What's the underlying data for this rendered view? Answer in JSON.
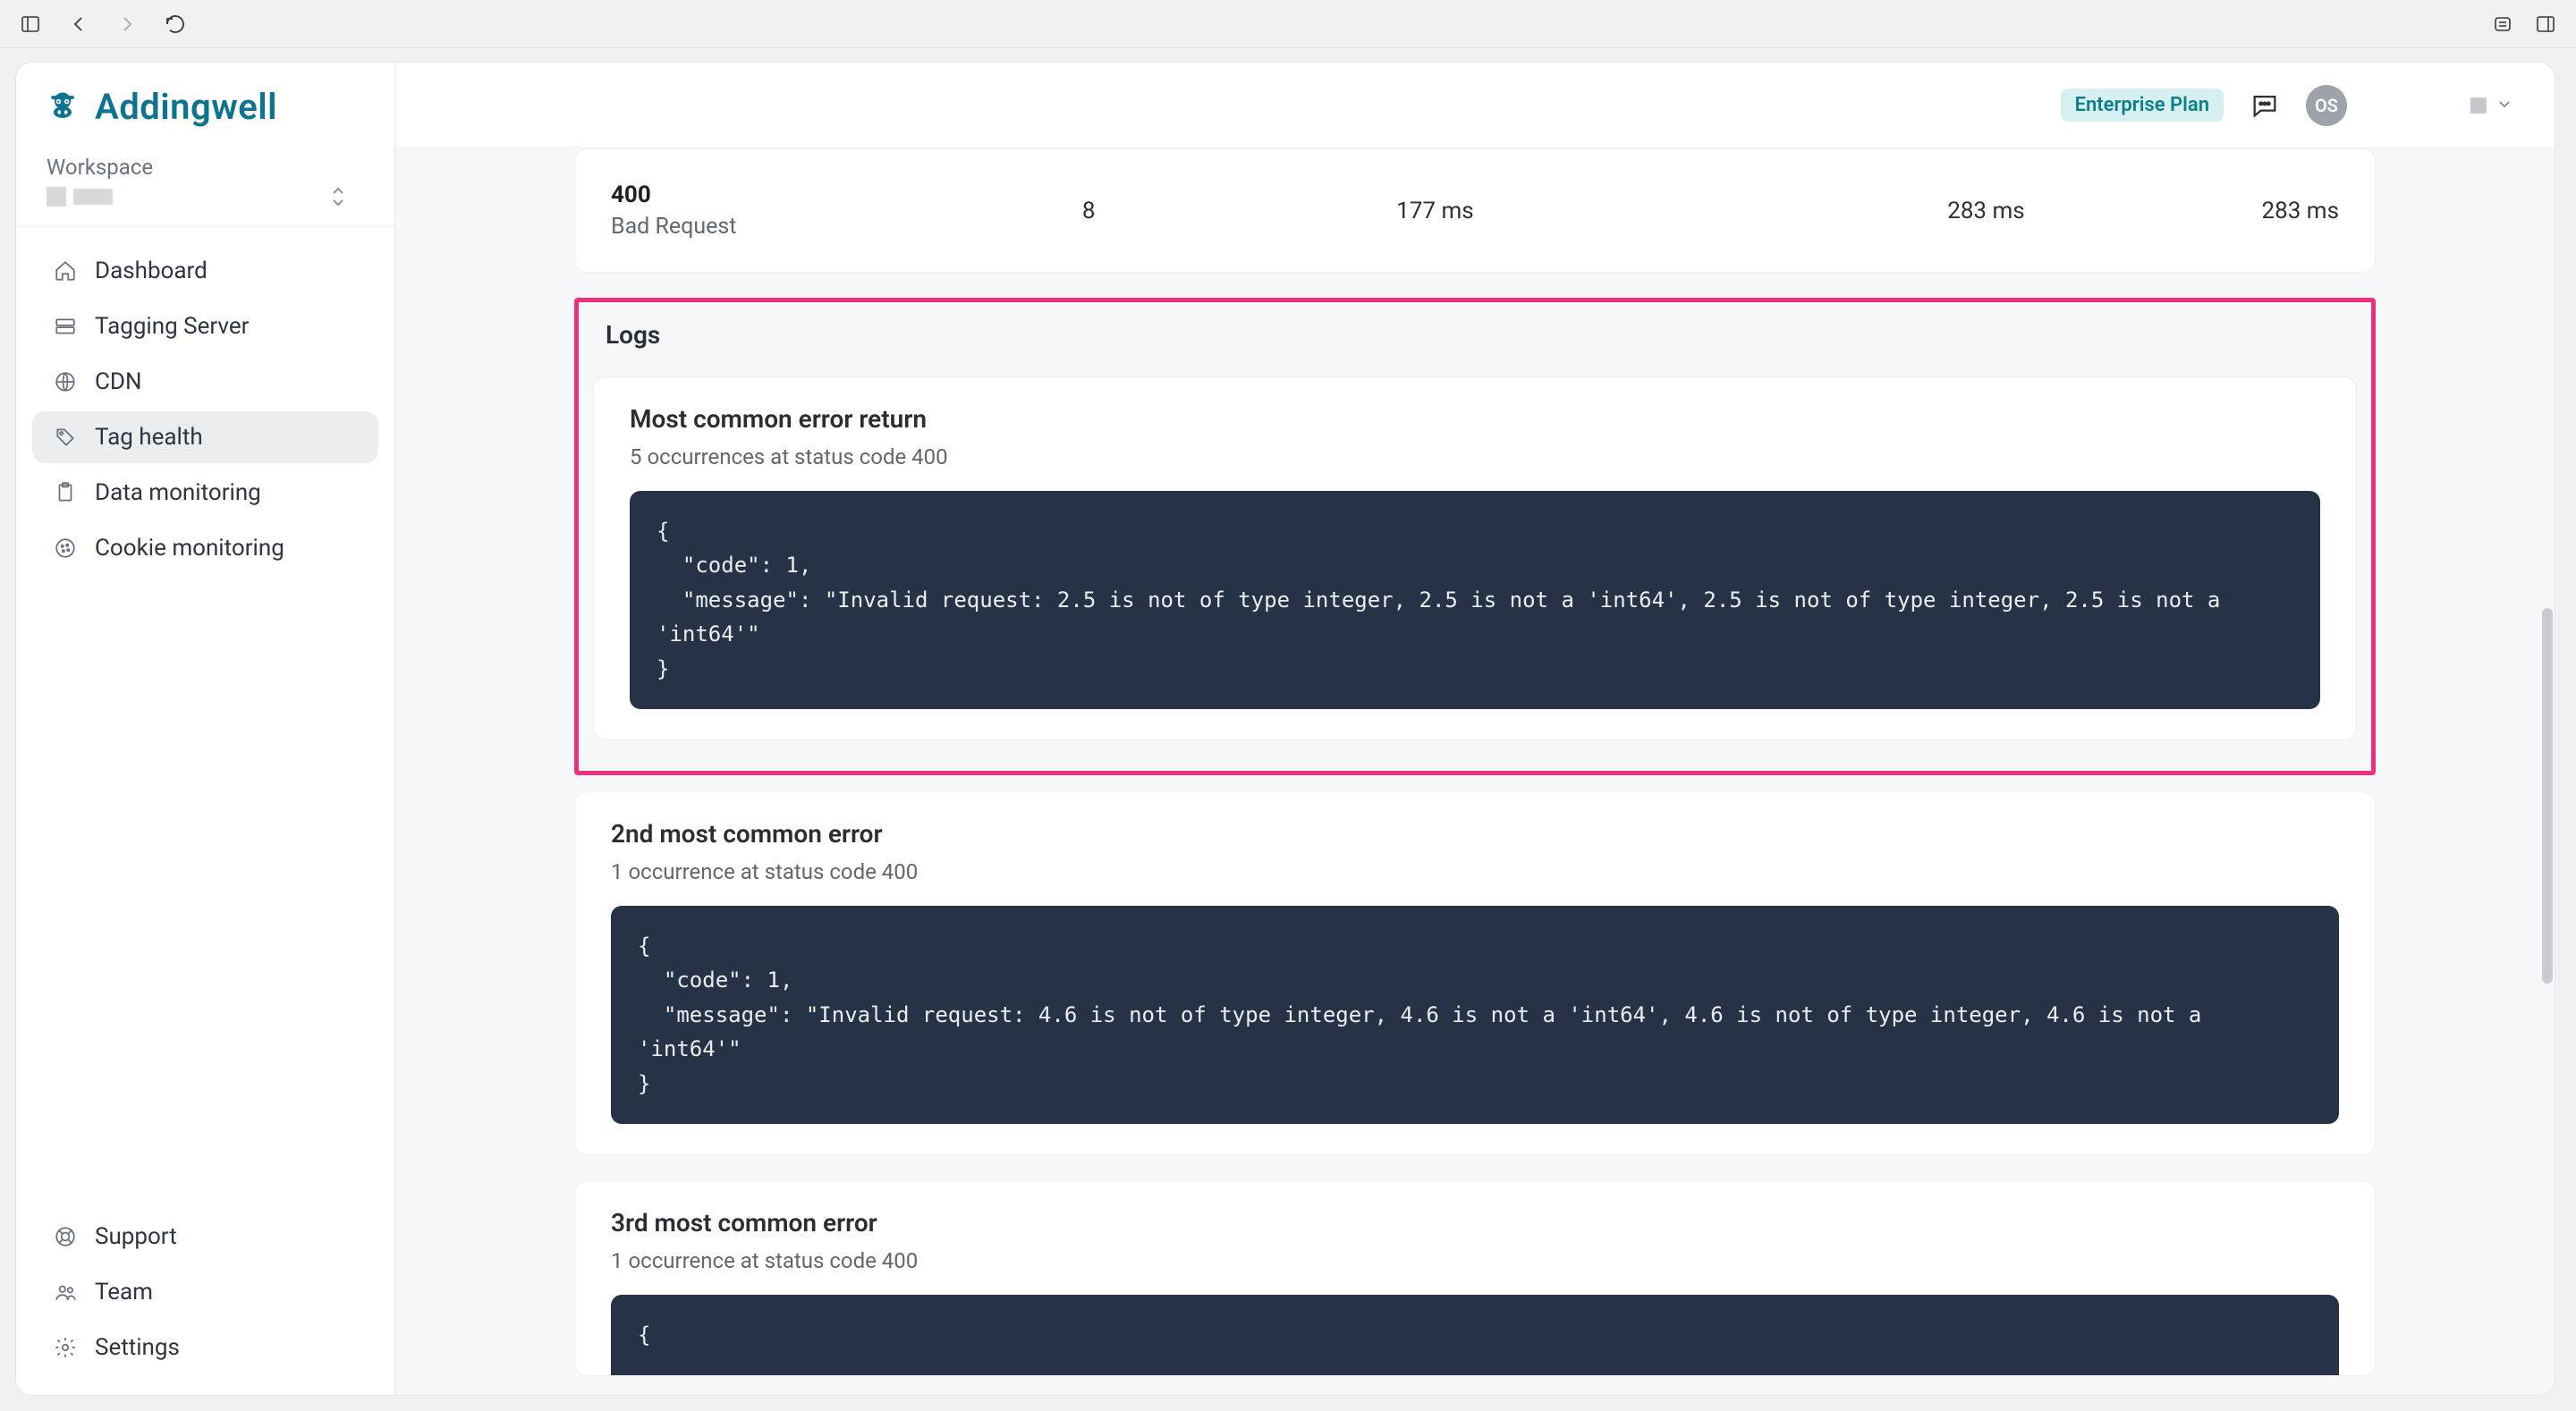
{
  "brand": {
    "name": "Addingwell"
  },
  "workspace": {
    "label": "Workspace"
  },
  "topbar": {
    "plan": "Enterprise Plan",
    "avatar_initials": "OS"
  },
  "sidebar": {
    "items": [
      {
        "label": "Dashboard"
      },
      {
        "label": "Tagging Server"
      },
      {
        "label": "CDN"
      },
      {
        "label": "Tag health"
      },
      {
        "label": "Data monitoring"
      },
      {
        "label": "Cookie monitoring"
      }
    ],
    "bottom": [
      {
        "label": "Support"
      },
      {
        "label": "Team"
      },
      {
        "label": "Settings"
      }
    ]
  },
  "status_row": {
    "code": "400",
    "text": "Bad Request",
    "count": "8",
    "p50": "177 ms",
    "p90": "283 ms",
    "p99": "283 ms"
  },
  "logs": {
    "heading": "Logs",
    "errors": [
      {
        "title": "Most common error return",
        "subtitle": "5 occurrences at status code 400",
        "body": "{\n  \"code\": 1,\n  \"message\": \"Invalid request: 2.5 is not of type integer, 2.5 is not a 'int64', 2.5 is not of type integer, 2.5 is not a 'int64'\"\n}"
      },
      {
        "title": "2nd most common error",
        "subtitle": "1 occurrence at status code 400",
        "body": "{\n  \"code\": 1,\n  \"message\": \"Invalid request: 4.6 is not of type integer, 4.6 is not a 'int64', 4.6 is not of type integer, 4.6 is not a 'int64'\"\n}"
      },
      {
        "title": "3rd most common error",
        "subtitle": "1 occurrence at status code 400",
        "body": "{"
      }
    ]
  }
}
